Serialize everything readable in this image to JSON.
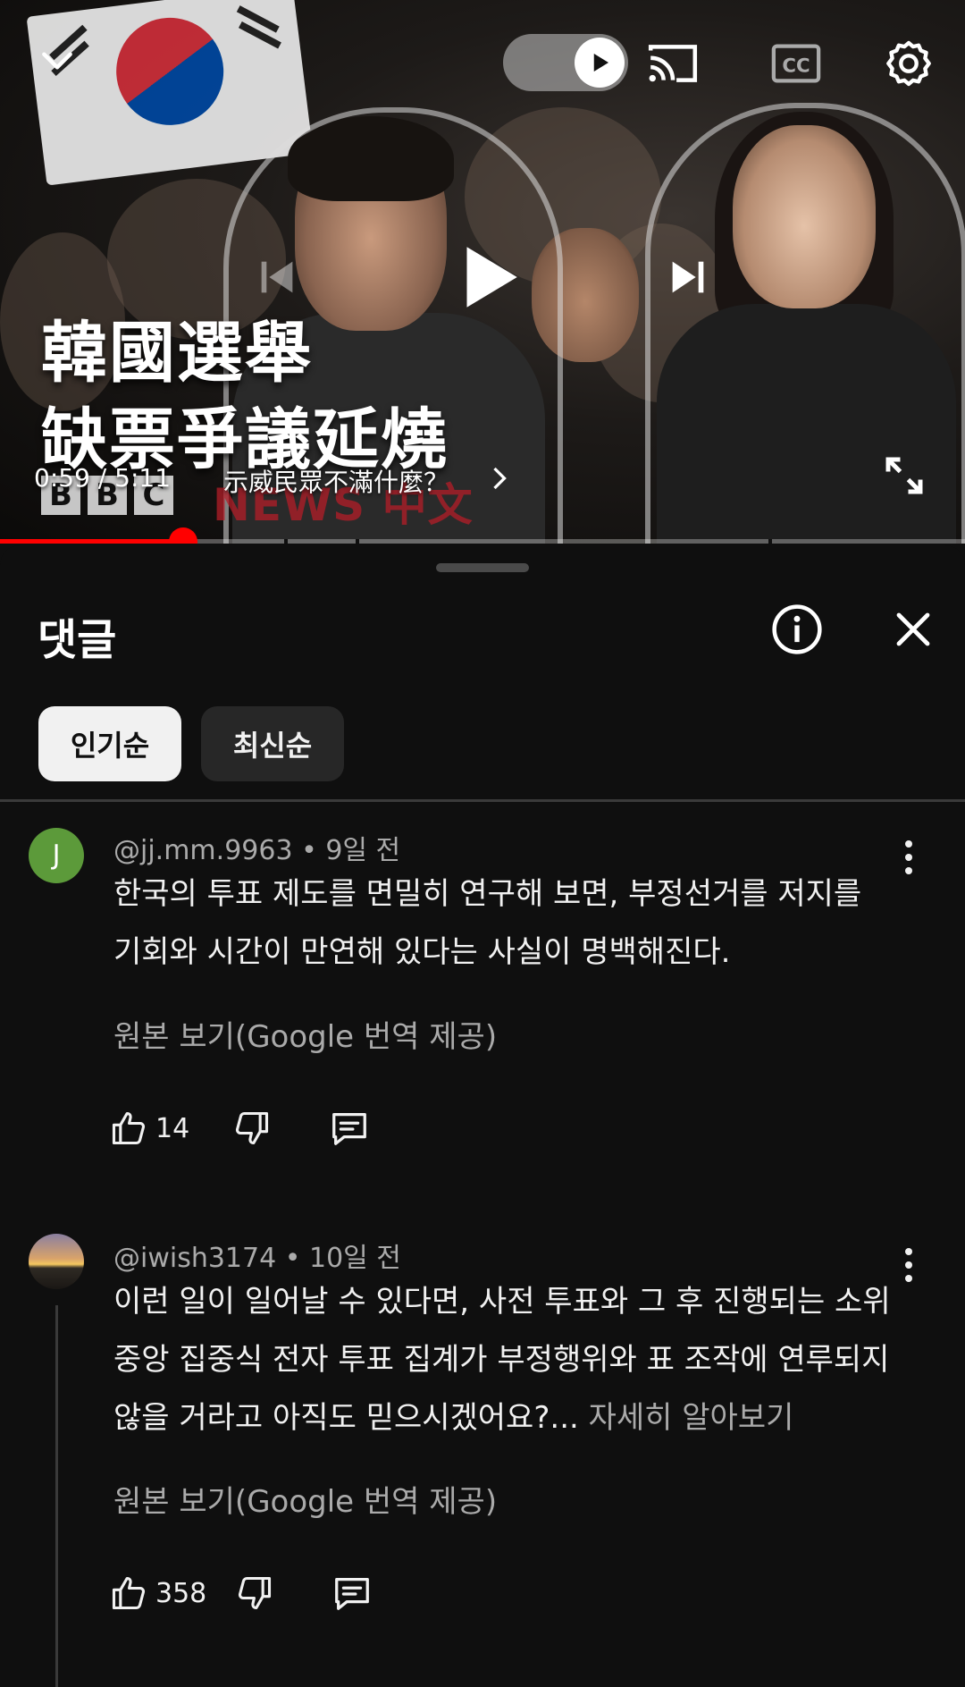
{
  "player": {
    "headline_line1": "韓國選舉",
    "headline_line2": "缺票爭議延燒",
    "brand_letters": [
      "B",
      "B",
      "C"
    ],
    "brand_news": "NEWS 中文",
    "current_time": "0:59",
    "time_separator": "/",
    "duration": "5:11",
    "chapter_title": "示威民眾不滿什麼？",
    "progress_fraction": 0.19,
    "accent_color": "#ff0000",
    "icons": [
      "chevron-down-icon",
      "autoplay-toggle",
      "cast-icon",
      "cc-icon",
      "settings-gear-icon",
      "previous-icon",
      "play-icon",
      "next-icon",
      "fullscreen-icon"
    ]
  },
  "comments_panel": {
    "title": "댓글",
    "filters": [
      {
        "label": "인기순",
        "selected": true
      },
      {
        "label": "최신순",
        "selected": false
      }
    ],
    "comments": [
      {
        "avatar_letter": "J",
        "handle": "@jj.mm.9963",
        "age": "9일 전",
        "lines": [
          "한국의 투표 제도를 면밀히 연구해 보면, 부정선거를 저지를",
          "기회와 시간이 만연해 있다는 사실이 명백해진다."
        ],
        "translation_note": "원본 보기(Google 번역 제공)",
        "likes": "14"
      },
      {
        "avatar_letter": "",
        "handle": "@iwish3174",
        "age": "10일 전",
        "lines": [
          "이런 일이 일어날 수 있다면, 사전 투표와 그 후 진행되는 소위",
          "중앙 집중식 전자 투표 집계가 부정행위와 표 조작에 연루되지",
          "않을 거라고 아직도 믿으시겠어요?..."
        ],
        "read_more": "자세히 알아보기",
        "translation_note": "원본 보기(Google 번역 제공)",
        "likes": "358"
      }
    ]
  }
}
